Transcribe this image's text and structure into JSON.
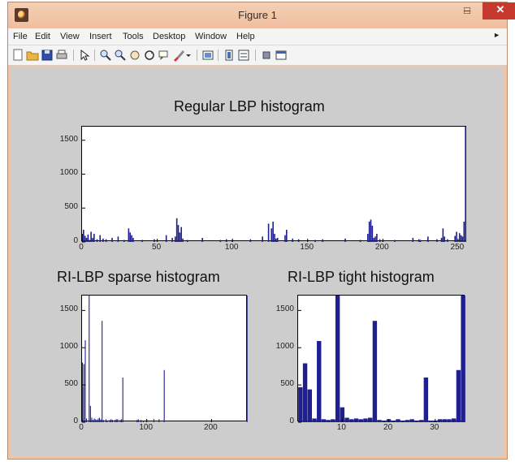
{
  "window": {
    "title": "Figure 1",
    "minimize_glyph": "–",
    "maximize_glyph": "□",
    "close_glyph": "✕"
  },
  "menu": [
    "File",
    "Edit",
    "View",
    "Insert",
    "Tools",
    "Desktop",
    "Window",
    "Help"
  ],
  "toolbar": {
    "icons": [
      "new-figure-icon",
      "open-file-icon",
      "save-icon",
      "print-icon",
      "pointer-icon",
      "zoom-in-icon",
      "zoom-out-icon",
      "pan-icon",
      "rotate-3d-icon",
      "data-cursor-icon",
      "brush-icon",
      "link-icon",
      "colorbar-icon",
      "legend-icon",
      "hide-plot-tools-icon",
      "show-plot-tools-icon"
    ]
  },
  "colors": {
    "bar": "#1f1f8f",
    "canvas": "#cdcdcd"
  },
  "chart_data": [
    {
      "type": "bar",
      "title": "Regular LBP histogram",
      "xlim": [
        0,
        256
      ],
      "ylim": [
        0,
        1700
      ],
      "xticks": [
        0,
        50,
        100,
        150,
        200,
        250
      ],
      "yticks": [
        0,
        500,
        1000,
        1500
      ],
      "bars": [
        [
          0,
          120
        ],
        [
          1,
          180
        ],
        [
          2,
          90
        ],
        [
          3,
          60
        ],
        [
          4,
          110
        ],
        [
          5,
          30
        ],
        [
          6,
          150
        ],
        [
          7,
          60
        ],
        [
          8,
          120
        ],
        [
          10,
          40
        ],
        [
          12,
          100
        ],
        [
          14,
          50
        ],
        [
          16,
          40
        ],
        [
          20,
          60
        ],
        [
          24,
          80
        ],
        [
          28,
          30
        ],
        [
          31,
          200
        ],
        [
          32,
          140
        ],
        [
          33,
          100
        ],
        [
          34,
          60
        ],
        [
          40,
          30
        ],
        [
          48,
          40
        ],
        [
          56,
          100
        ],
        [
          60,
          60
        ],
        [
          62,
          80
        ],
        [
          63,
          350
        ],
        [
          64,
          250
        ],
        [
          65,
          140
        ],
        [
          66,
          220
        ],
        [
          67,
          50
        ],
        [
          70,
          30
        ],
        [
          80,
          60
        ],
        [
          92,
          30
        ],
        [
          96,
          40
        ],
        [
          100,
          30
        ],
        [
          112,
          40
        ],
        [
          120,
          80
        ],
        [
          124,
          270
        ],
        [
          126,
          200
        ],
        [
          127,
          300
        ],
        [
          128,
          120
        ],
        [
          129,
          50
        ],
        [
          130,
          60
        ],
        [
          135,
          100
        ],
        [
          136,
          180
        ],
        [
          140,
          50
        ],
        [
          144,
          40
        ],
        [
          155,
          30
        ],
        [
          160,
          40
        ],
        [
          175,
          50
        ],
        [
          185,
          30
        ],
        [
          190,
          120
        ],
        [
          191,
          300
        ],
        [
          192,
          330
        ],
        [
          193,
          240
        ],
        [
          194,
          60
        ],
        [
          195,
          80
        ],
        [
          196,
          120
        ],
        [
          198,
          40
        ],
        [
          200,
          20
        ],
        [
          208,
          30
        ],
        [
          220,
          60
        ],
        [
          224,
          40
        ],
        [
          225,
          30
        ],
        [
          230,
          80
        ],
        [
          236,
          40
        ],
        [
          239,
          60
        ],
        [
          240,
          200
        ],
        [
          241,
          80
        ],
        [
          243,
          40
        ],
        [
          248,
          90
        ],
        [
          249,
          150
        ],
        [
          251,
          130
        ],
        [
          252,
          100
        ],
        [
          253,
          80
        ],
        [
          254,
          300
        ],
        [
          255,
          1700
        ]
      ]
    },
    {
      "type": "bar",
      "title": "RI-LBP sparse histogram",
      "xlim": [
        0,
        256
      ],
      "ylim": [
        0,
        1700
      ],
      "xticks": [
        0,
        100,
        200
      ],
      "yticks": [
        0,
        500,
        1000,
        1500
      ],
      "bars": [
        [
          0,
          800
        ],
        [
          1,
          470
        ],
        [
          3,
          780
        ],
        [
          5,
          1100
        ],
        [
          7,
          50
        ],
        [
          11,
          1720
        ],
        [
          13,
          220
        ],
        [
          15,
          60
        ],
        [
          17,
          30
        ],
        [
          19,
          50
        ],
        [
          21,
          40
        ],
        [
          23,
          30
        ],
        [
          25,
          50
        ],
        [
          27,
          60
        ],
        [
          29,
          40
        ],
        [
          31,
          1360
        ],
        [
          33,
          30
        ],
        [
          37,
          40
        ],
        [
          39,
          20
        ],
        [
          43,
          30
        ],
        [
          45,
          40
        ],
        [
          47,
          30
        ],
        [
          51,
          30
        ],
        [
          53,
          40
        ],
        [
          55,
          40
        ],
        [
          59,
          30
        ],
        [
          61,
          40
        ],
        [
          63,
          600
        ],
        [
          85,
          30
        ],
        [
          87,
          40
        ],
        [
          91,
          30
        ],
        [
          95,
          20
        ],
        [
          111,
          40
        ],
        [
          119,
          40
        ],
        [
          127,
          700
        ],
        [
          255,
          1750
        ]
      ]
    },
    {
      "type": "bar",
      "title": "RI-LBP tight histogram",
      "xlim": [
        0.5,
        36.5
      ],
      "ylim": [
        0,
        1700
      ],
      "xticks": [
        10,
        20,
        30
      ],
      "yticks": [
        0,
        500,
        1000,
        1500
      ],
      "bars": [
        [
          1,
          470
        ],
        [
          2,
          790
        ],
        [
          3,
          440
        ],
        [
          4,
          50
        ],
        [
          5,
          1090
        ],
        [
          6,
          40
        ],
        [
          7,
          30
        ],
        [
          8,
          40
        ],
        [
          9,
          1760
        ],
        [
          10,
          200
        ],
        [
          11,
          60
        ],
        [
          12,
          40
        ],
        [
          13,
          50
        ],
        [
          14,
          40
        ],
        [
          15,
          50
        ],
        [
          16,
          60
        ],
        [
          17,
          1360
        ],
        [
          18,
          30
        ],
        [
          19,
          20
        ],
        [
          20,
          40
        ],
        [
          21,
          20
        ],
        [
          22,
          40
        ],
        [
          23,
          20
        ],
        [
          24,
          30
        ],
        [
          25,
          40
        ],
        [
          26,
          20
        ],
        [
          27,
          30
        ],
        [
          28,
          600
        ],
        [
          29,
          20
        ],
        [
          30,
          20
        ],
        [
          31,
          40
        ],
        [
          32,
          40
        ],
        [
          33,
          40
        ],
        [
          34,
          50
        ],
        [
          35,
          700
        ],
        [
          36,
          1750
        ]
      ]
    }
  ]
}
